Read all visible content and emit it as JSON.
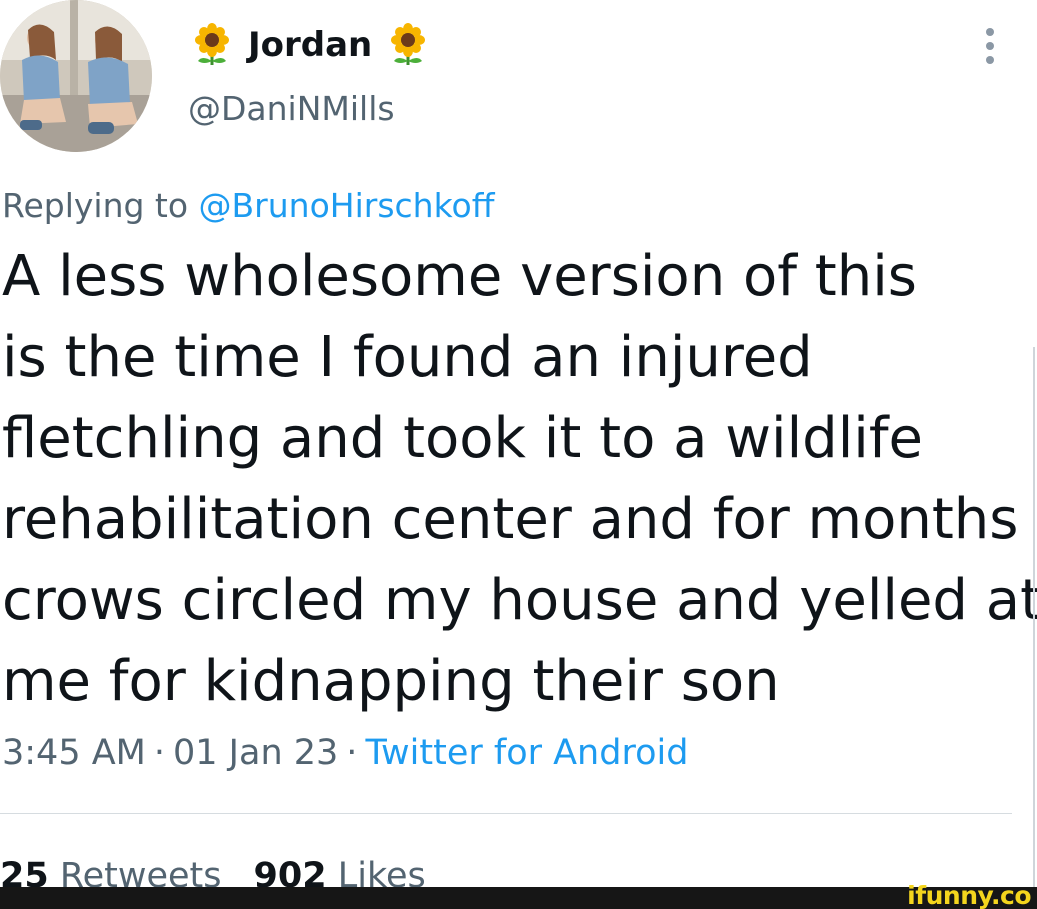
{
  "tweet": {
    "author": {
      "display_name": "Jordan",
      "name_emoji": "sunflower-icon",
      "handle": "@DaniNMills"
    },
    "more_icon": "more-options-icon",
    "replying_to": {
      "prefix": "Replying to",
      "handle": "@BrunoHirschkoff"
    },
    "text_lines": [
      "A less wholesome version of this",
      "is the time I found an injured",
      "fletchling and took it to a wildlife",
      "rehabilitation center and for months",
      "crows circled my house and yelled at",
      "me for kidnapping their son"
    ],
    "time": "3:45 AM",
    "date": "01 Jan 23",
    "separator": "·",
    "source": "Twitter for Android",
    "stats": {
      "retweets_count": "25",
      "retweets_label": "Retweets",
      "likes_count": "902",
      "likes_label": "Likes"
    }
  },
  "watermark": {
    "text": "ifunny.co"
  },
  "colors": {
    "link": "#1d9bf0",
    "secondary_text": "#536471",
    "primary_text": "#0f1419",
    "watermark": "#f4d51d"
  }
}
